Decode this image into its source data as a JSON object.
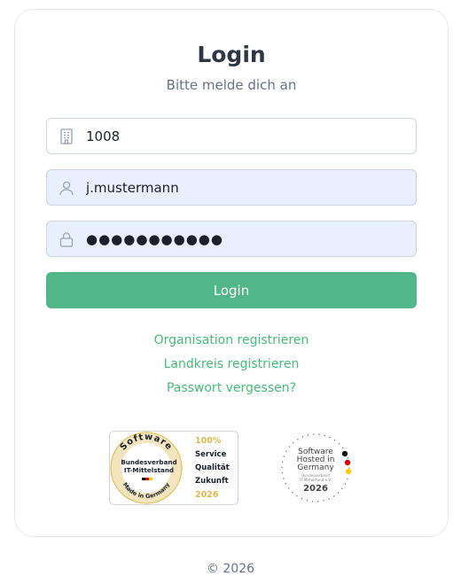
{
  "login": {
    "title": "Login",
    "subtitle": "Bitte melde dich an",
    "org_value": "1008",
    "username_value": "j.mustermann",
    "password_value": "●●●●●●●●●●●",
    "button_label": "Login"
  },
  "links": {
    "register_org": "Organisation registrieren",
    "register_district": "Landkreis registrieren",
    "forgot_password": "Passwort vergessen?"
  },
  "badges": {
    "software_made_in_germany": {
      "arc_top": "Software",
      "line1": "Bundesverband",
      "line2": "IT-Mittelstand",
      "arc_bottom": "Made in Germany",
      "percent": "100%",
      "service": "Service",
      "quality": "Qualität",
      "future": "Zukunft",
      "year": "2026"
    },
    "software_hosted_in_germany": {
      "line1": "Software",
      "line2": "Hosted in",
      "line3": "Germany",
      "small1": "Bundesverband",
      "small2": "IT-Mittelstand e.V.",
      "year": "2026"
    }
  },
  "footer": {
    "copyright": "© 2026"
  },
  "colors": {
    "accent": "#52b788",
    "link": "#48bb78",
    "field_fill": "#e8f0fe",
    "badge_gold": "#e0b84a"
  }
}
